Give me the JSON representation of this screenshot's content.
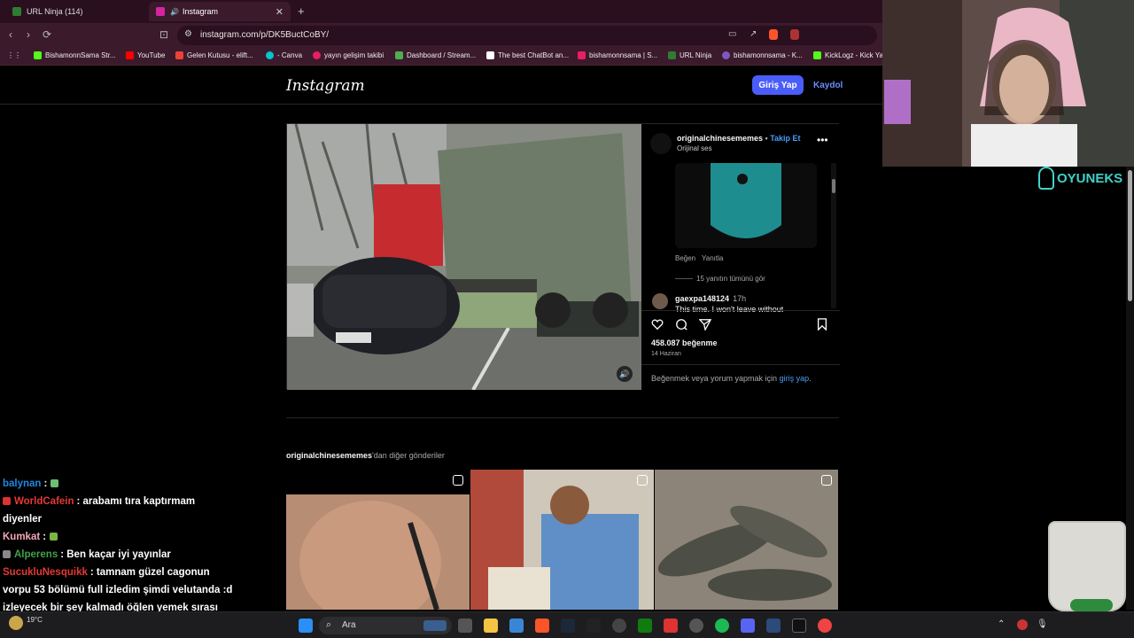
{
  "browser": {
    "tabs": [
      {
        "title": "URL Ninja (114)",
        "color": "#2e7d32"
      },
      {
        "title": "Instagram",
        "color": "#d6249f"
      }
    ],
    "url": "instagram.com/p/DK5BuctCoBY/",
    "bookmarks": [
      {
        "label": "BishamonnSama Str...",
        "color": "#53fc18"
      },
      {
        "label": "YouTube",
        "color": "#ff0000"
      },
      {
        "label": "Gelen Kutusu - elift...",
        "color": "#ea4335"
      },
      {
        "label": "- Canva",
        "color": "#00c4cc"
      },
      {
        "label": "yayın gelişim takibi",
        "color": "#e91e63"
      },
      {
        "label": "Dashboard / Stream...",
        "color": "#4caf50"
      },
      {
        "label": "The best ChatBot an...",
        "color": "#ffffff"
      },
      {
        "label": "bishamonnsama | S...",
        "color": "#e91e63"
      },
      {
        "label": "URL Ninja",
        "color": "#2e7d32"
      },
      {
        "label": "bishamonnsama - K...",
        "color": "#7e57c2"
      },
      {
        "label": "KickLogz - Kick Yay...",
        "color": "#53fc18"
      }
    ]
  },
  "instagram": {
    "logo": "Instagram",
    "login_button": "Giriş Yap",
    "signup_link": "Kaydol",
    "post": {
      "username": "originalchinesememes",
      "separator": " • ",
      "follow": "Takip Et",
      "audio": "Orijinal ses",
      "comment_actions": {
        "like": "Beğen",
        "reply": "Yanıtla"
      },
      "view_replies": "15 yanıtın tümünü gör",
      "comment2": {
        "user": "gaexpa148124",
        "time": "17h",
        "text": "This time, I won't leave without"
      },
      "likes": "458.087 beğenme",
      "date": "14 Haziran",
      "login_prompt_prefix": "Beğenmek veya yorum yapmak için ",
      "login_prompt_link": "giriş yap",
      "login_prompt_suffix": "."
    },
    "more_posts": {
      "username": "originalchinesememes",
      "suffix": "'dan diğer gönderiler"
    }
  },
  "overlay": {
    "brand": "OYUNEKS",
    "chat": [
      {
        "user": "balynan",
        "text": ":",
        "color": "#1e88e5"
      },
      {
        "user": "WorldCafein",
        "text": ": arabamı tıra kaptırmam diyenler",
        "color": "#e53935"
      },
      {
        "user": "Kumkat",
        "text": ":",
        "color": "#f4a6b9"
      },
      {
        "user": "Alperens",
        "text": ": Ben kaçar iyi yayınlar",
        "color": "#43a047"
      },
      {
        "user": "SucukluNesquikk",
        "text": ": tamnam güzel cagonun vorpu 53 bölümü full izledim şimdi velutanda :d izleyecek bir şey kalmadı öğlen yemek sırası",
        "color": "#e53935"
      }
    ]
  },
  "taskbar": {
    "search": "Ara",
    "weather": "19°C"
  }
}
